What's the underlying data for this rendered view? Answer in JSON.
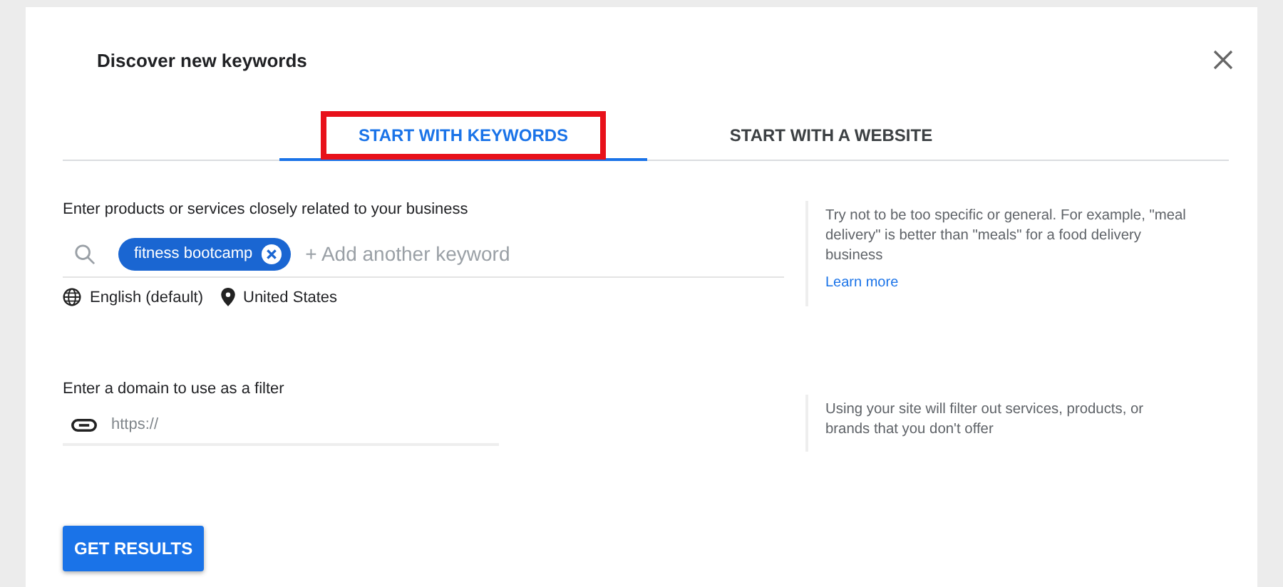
{
  "dialog": {
    "title": "Discover new keywords"
  },
  "tabs": [
    {
      "label": "START WITH KEYWORDS",
      "selected": true,
      "highlighted": true
    },
    {
      "label": "START WITH A WEBSITE",
      "selected": false,
      "highlighted": false
    }
  ],
  "keywords": {
    "label": "Enter products or services closely related to your business",
    "chips": [
      "fitness bootcamp"
    ],
    "placeholder": "+ Add another keyword",
    "language": "English (default)",
    "location": "United States",
    "hint": "Try not to be too specific or general. For example, \"meal delivery\" is better than \"meals\" for a food delivery business",
    "link": "Learn more"
  },
  "domain": {
    "label": "Enter a domain to use as a filter",
    "placeholder": "https://",
    "hint": "Using your site will filter out services, products, or brands that you don't offer"
  },
  "button": "GET RESULTS"
}
